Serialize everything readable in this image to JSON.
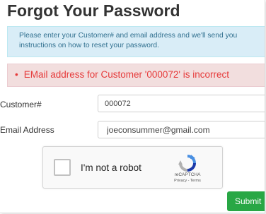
{
  "page": {
    "title": "Forgot Your Password"
  },
  "info": {
    "line1": "Please enter your Customer# and email address and we'll send you",
    "line2": "instructions on  how to reset your password."
  },
  "error": {
    "bullet": "•",
    "message": "EMail address for Customer '000072' is incorrect"
  },
  "form": {
    "customer_label": "Customer#",
    "customer_value": "000072",
    "email_label": "Email Address",
    "email_value": "joeconsummer@gmail.com"
  },
  "recaptcha": {
    "label": "I'm not a robot",
    "brand": "reCAPTCHA",
    "terms": "Privacy - Terms"
  },
  "actions": {
    "submit_label": "Submit"
  },
  "colors": {
    "info_bg": "#d9edf7",
    "info_text": "#31708f",
    "error_bg": "#f2dede",
    "error_text": "#e63b3b",
    "submit_bg": "#28a745"
  }
}
